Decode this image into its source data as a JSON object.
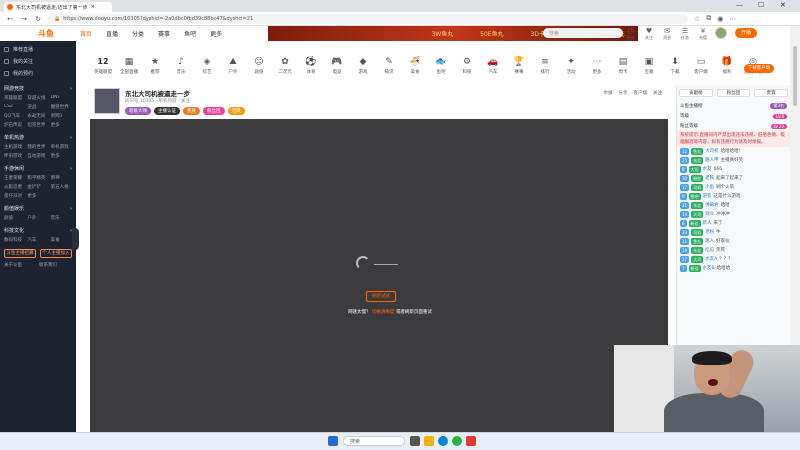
{
  "browser": {
    "tab_title": "东北大司机被逼走,迈出了第一步",
    "url": "https://www.douyu.com/10305?dyshid=-2a0dbc0fbd39c88bc47&dyshci=21",
    "window_controls": [
      "—",
      "☐",
      "✕"
    ]
  },
  "site": {
    "logo": "斗鱼",
    "nav": [
      {
        "label": "首页",
        "active": true
      },
      {
        "label": "直播",
        "active": false
      },
      {
        "label": "分类",
        "active": false
      },
      {
        "label": "赛事",
        "active": false
      },
      {
        "label": "鱼吧",
        "active": false
      },
      {
        "label": "更多",
        "active": false
      }
    ],
    "banner_items": [
      "3W鱼丸",
      "50E鱼丸",
      "3D卡卡",
      "1元",
      "1元"
    ],
    "search_placeholder": "搜索",
    "header_icons": [
      {
        "icon": "history-icon",
        "label": "历史"
      },
      {
        "icon": "follow-icon",
        "label": "关注"
      },
      {
        "icon": "message-icon",
        "label": "消息"
      },
      {
        "icon": "task-icon",
        "label": "任务"
      },
      {
        "icon": "pay-icon",
        "label": "充值"
      }
    ],
    "start_live": "开播"
  },
  "sidebar": {
    "top_items": [
      "推荐直播",
      "我的关注",
      "我的预约"
    ],
    "sections": [
      {
        "title": "网游竞技",
        "items": [
          "英雄联盟",
          "穿越火线",
          "DNF",
          "CS2",
          "逆战",
          "魔兽世界",
          "QQ飞车",
          "永劫无间",
          "剑网3",
          "炉石传说",
          "坦克世界",
          "更多"
        ]
      },
      {
        "title": "单机热游",
        "items": [
          "主机游戏",
          "我的世界",
          "单机游戏",
          "怀旧游戏",
          "互动游戏",
          "更多"
        ]
      },
      {
        "title": "手游休闲",
        "items": [
          "王者荣耀",
          "和平精英",
          "原神",
          "火影忍者",
          "金铲铲",
          "第五人格",
          "蛋仔派对",
          "更多"
        ]
      },
      {
        "title": "颜值娱乐",
        "items": [
          "颜值",
          "户外",
          "音乐"
        ]
      },
      {
        "title": "科技文化",
        "items": [
          "数码科技",
          "汽车",
          "美食"
        ]
      }
    ],
    "bottom_buttons": [
      "斗鱼主播招募",
      "个人主播加入"
    ],
    "footer": [
      "关于斗鱼",
      "联系我们"
    ]
  },
  "categories": [
    {
      "label": "12",
      "sub": "英雄联盟",
      "icon": "number-icon"
    },
    {
      "label": "全部直播",
      "icon": "all-icon"
    },
    {
      "label": "推荐",
      "icon": "recommend-icon"
    },
    {
      "label": "音乐",
      "icon": "music-icon"
    },
    {
      "label": "综艺",
      "icon": "variety-icon"
    },
    {
      "label": "户外",
      "icon": "outdoor-icon"
    },
    {
      "label": "颜值",
      "icon": "beauty-icon"
    },
    {
      "label": "二次元",
      "icon": "anime-icon"
    },
    {
      "label": "体育",
      "icon": "sports-icon"
    },
    {
      "label": "电竞",
      "icon": "esports-icon"
    },
    {
      "label": "游戏",
      "icon": "game-icon"
    },
    {
      "label": "知识",
      "icon": "knowledge-icon"
    },
    {
      "label": "美食",
      "icon": "food-icon"
    },
    {
      "label": "鱼吧",
      "icon": "fishbar-icon"
    },
    {
      "label": "科技",
      "icon": "tech-icon"
    },
    {
      "label": "汽车",
      "icon": "car-icon"
    },
    {
      "label": "赛事",
      "icon": "match-icon"
    },
    {
      "label": "排行",
      "icon": "rank-icon"
    },
    {
      "label": "活动",
      "icon": "event-icon"
    },
    {
      "label": "更多",
      "icon": "more-icon"
    },
    {
      "label": "周卡",
      "icon": "card-icon"
    },
    {
      "label": "宝箱",
      "icon": "chest-icon"
    },
    {
      "label": "下载",
      "icon": "download-icon"
    },
    {
      "label": "客户端",
      "icon": "client-icon"
    },
    {
      "label": "福利",
      "icon": "gift-icon"
    },
    {
      "label": "游戏中心",
      "icon": "gamecenter-icon"
    }
  ],
  "download_button": "下载客户端",
  "room": {
    "title": "东北大司机被逼走一步",
    "sub": "房间号 10305 · 单机热游 · 关注",
    "tags": [
      {
        "label": "超级大咖",
        "color": "#9b59b6"
      },
      {
        "label": "主播认证",
        "color": "#333"
      },
      {
        "label": "贵族",
        "color": "#e67e22"
      },
      {
        "label": "粉丝团",
        "color": "#e84393"
      },
      {
        "label": "活跃",
        "color": "#f39c12"
      }
    ],
    "right_actions": [
      "举报",
      "分享",
      "客户端",
      "关注"
    ]
  },
  "video": {
    "button": "刷新试试",
    "message_pre": "网速太慢？",
    "message_link": "切换清晰度",
    "message_post": "或者刷新页面重试"
  },
  "chat": {
    "tabs": [
      "贡献榜",
      "粉丝团",
      "贵宾"
    ],
    "top_rows": [
      {
        "label": "斗鱼主播榜",
        "pill": "第3名",
        "pill_color": "#9b59b6"
      },
      {
        "label": "等级",
        "pill": "LV.8",
        "pill_color": "#e84393"
      },
      {
        "label": "粉丝等级",
        "pill": "LV.20",
        "pill_color": "#e84393"
      }
    ],
    "system": "系统提示:直播间内严禁出现违法违规、低俗色情、吸烟酗酒等内容，如有违规行为请及时举报。",
    "messages": [
      {
        "lv": "12",
        "fb": "鱼丸",
        "user": "大司机",
        "text": "哈哈哈哈！",
        "red": false
      },
      {
        "lv": "25",
        "fb": "东北",
        "user": "路人甲",
        "text": "主播真好笑",
        "red": false
      },
      {
        "lv": "8",
        "fb": "大司",
        "user": "水友",
        "text": "666",
        "red": false
      },
      {
        "lv": "30",
        "fb": "粉丝",
        "user": "老铁",
        "text": "起来了起来了",
        "red": false
      },
      {
        "lv": "17",
        "fb": "司机",
        "user": "小鱼",
        "text": "刷个火箭",
        "red": false
      },
      {
        "lv": "9",
        "fb": "鱼吧",
        "user": "游客",
        "text": "这是什么游戏",
        "red": false
      },
      {
        "lv": "21",
        "fb": "东北",
        "user": "弹幕君",
        "text": "哈哈",
        "red": false
      },
      {
        "lv": "14",
        "fb": "大司",
        "user": "观众",
        "text": "冲冲冲",
        "red": false
      },
      {
        "lv": "6",
        "fb": "粉丝",
        "user": "新人",
        "text": "来了",
        "red": false
      },
      {
        "lv": "33",
        "fb": "司机",
        "user": "老粉",
        "text": "牛",
        "red": false
      },
      {
        "lv": "11",
        "fb": "鱼丸",
        "user": "路人",
        "text": "好家伙",
        "red": false
      },
      {
        "lv": "19",
        "fb": "东北",
        "user": "吃瓜",
        "text": "笑死",
        "red": false
      },
      {
        "lv": "27",
        "fb": "大司",
        "user": "水友A",
        "text": "？？？",
        "red": false
      },
      {
        "lv": "7",
        "fb": "粉丝",
        "user": "水友B",
        "text": "哈哈哈",
        "red": false
      }
    ]
  },
  "taskbar": {
    "search_placeholder": "搜索"
  },
  "colors": {
    "accent": "#ff6600",
    "sidebar_bg": "#1e2331",
    "video_bg": "#3b3b3d"
  }
}
